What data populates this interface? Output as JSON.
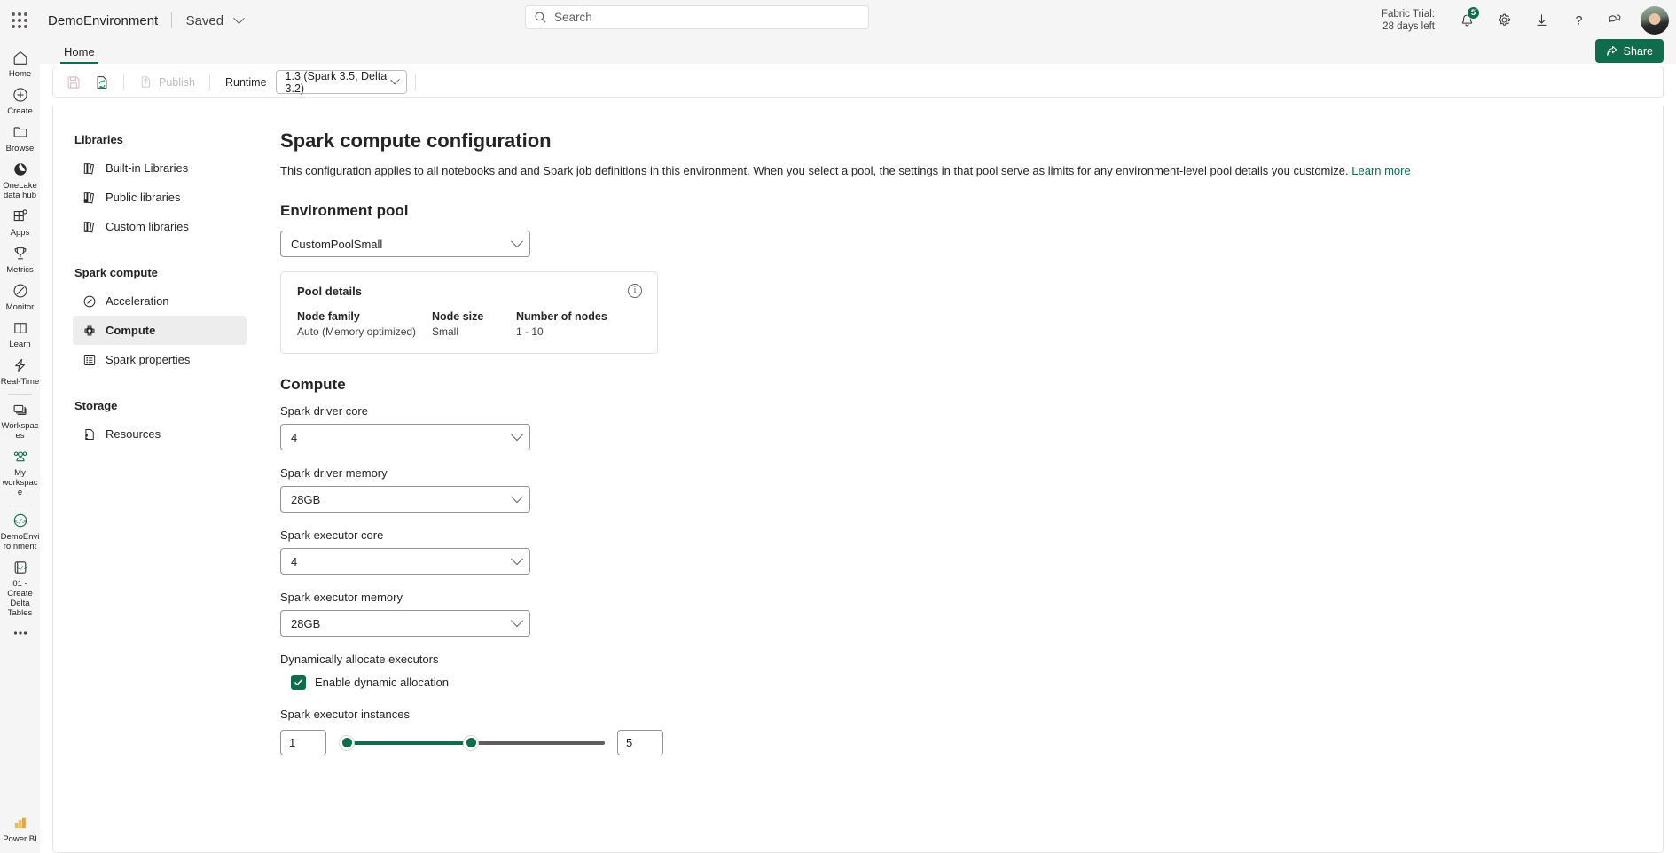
{
  "topbar": {
    "waffle_label": "App launcher",
    "app_title": "DemoEnvironment",
    "saved_label": "Saved",
    "search_placeholder": "Search",
    "trial_line1": "Fabric Trial:",
    "trial_line2": "28 days left",
    "notification_count": "5",
    "accent_color": "#0f6c4d"
  },
  "rail": {
    "items": [
      {
        "label": "Home",
        "icon": "home-icon"
      },
      {
        "label": "Create",
        "icon": "plus-circle-icon"
      },
      {
        "label": "Browse",
        "icon": "folder-icon"
      },
      {
        "label": "OneLake\ndata hub",
        "icon": "onelake-icon"
      },
      {
        "label": "Apps",
        "icon": "apps-icon"
      },
      {
        "label": "Metrics",
        "icon": "trophy-icon"
      },
      {
        "label": "Monitor",
        "icon": "compass-icon"
      },
      {
        "label": "Learn",
        "icon": "book-icon"
      },
      {
        "label": "Real-Time",
        "icon": "lightning-icon"
      },
      {
        "label": "Workspaces",
        "icon": "workspaces-icon"
      },
      {
        "label": "My\nworkspace",
        "icon": "people-icon"
      },
      {
        "label": "DemoEnviro\nnment",
        "icon": "environment-code-icon"
      },
      {
        "label": "01 - Create\nDelta Tables",
        "icon": "notebook-code-icon"
      }
    ],
    "more_label": "More options",
    "footer_label": "Power BI"
  },
  "ribbon": {
    "tab_home": "Home",
    "share_label": "Share"
  },
  "toolbar": {
    "save_label": "Save",
    "refresh_label": "Refresh",
    "publish_label": "Publish",
    "runtime_label": "Runtime",
    "runtime_value": "1.3 (Spark 3.5, Delta 3.2)"
  },
  "left_nav": {
    "groups": [
      {
        "heading": "Libraries",
        "items": [
          {
            "label": "Built-in Libraries",
            "icon": "books-icon",
            "active": false
          },
          {
            "label": "Public libraries",
            "icon": "public-books-icon",
            "active": false
          },
          {
            "label": "Custom libraries",
            "icon": "custom-books-icon",
            "active": false
          }
        ]
      },
      {
        "heading": "Spark compute",
        "items": [
          {
            "label": "Acceleration",
            "icon": "gauge-icon",
            "active": false
          },
          {
            "label": "Compute",
            "icon": "chip-icon",
            "active": true
          },
          {
            "label": "Spark properties",
            "icon": "list-icon",
            "active": false
          }
        ]
      },
      {
        "heading": "Storage",
        "items": [
          {
            "label": "Resources",
            "icon": "file-person-icon",
            "active": false
          }
        ]
      }
    ]
  },
  "main": {
    "page_title": "Spark compute configuration",
    "description": "This configuration applies to all notebooks and and Spark job definitions in this environment. When you select a pool, the settings in that pool serve as limits for any environment-level pool details you customize.",
    "learn_more": "Learn more",
    "environment_pool": {
      "heading": "Environment pool",
      "selected": "CustomPoolSmall",
      "pool_details": {
        "title": "Pool details",
        "columns": [
          {
            "header": "Node family",
            "value": "Auto (Memory optimized)"
          },
          {
            "header": "Node size",
            "value": "Small"
          },
          {
            "header": "Number of nodes",
            "value": "1 - 10"
          }
        ]
      }
    },
    "compute": {
      "heading": "Compute",
      "fields": [
        {
          "label": "Spark driver core",
          "value": "4"
        },
        {
          "label": "Spark driver memory",
          "value": "28GB"
        },
        {
          "label": "Spark executor core",
          "value": "4"
        },
        {
          "label": "Spark executor memory",
          "value": "28GB"
        }
      ],
      "dynamic_alloc_label": "Dynamically allocate executors",
      "enable_dynamic_label": "Enable dynamic allocation",
      "enable_dynamic_checked": true,
      "instances_label": "Spark executor instances",
      "instances_min": "1",
      "instances_max": "5"
    }
  }
}
